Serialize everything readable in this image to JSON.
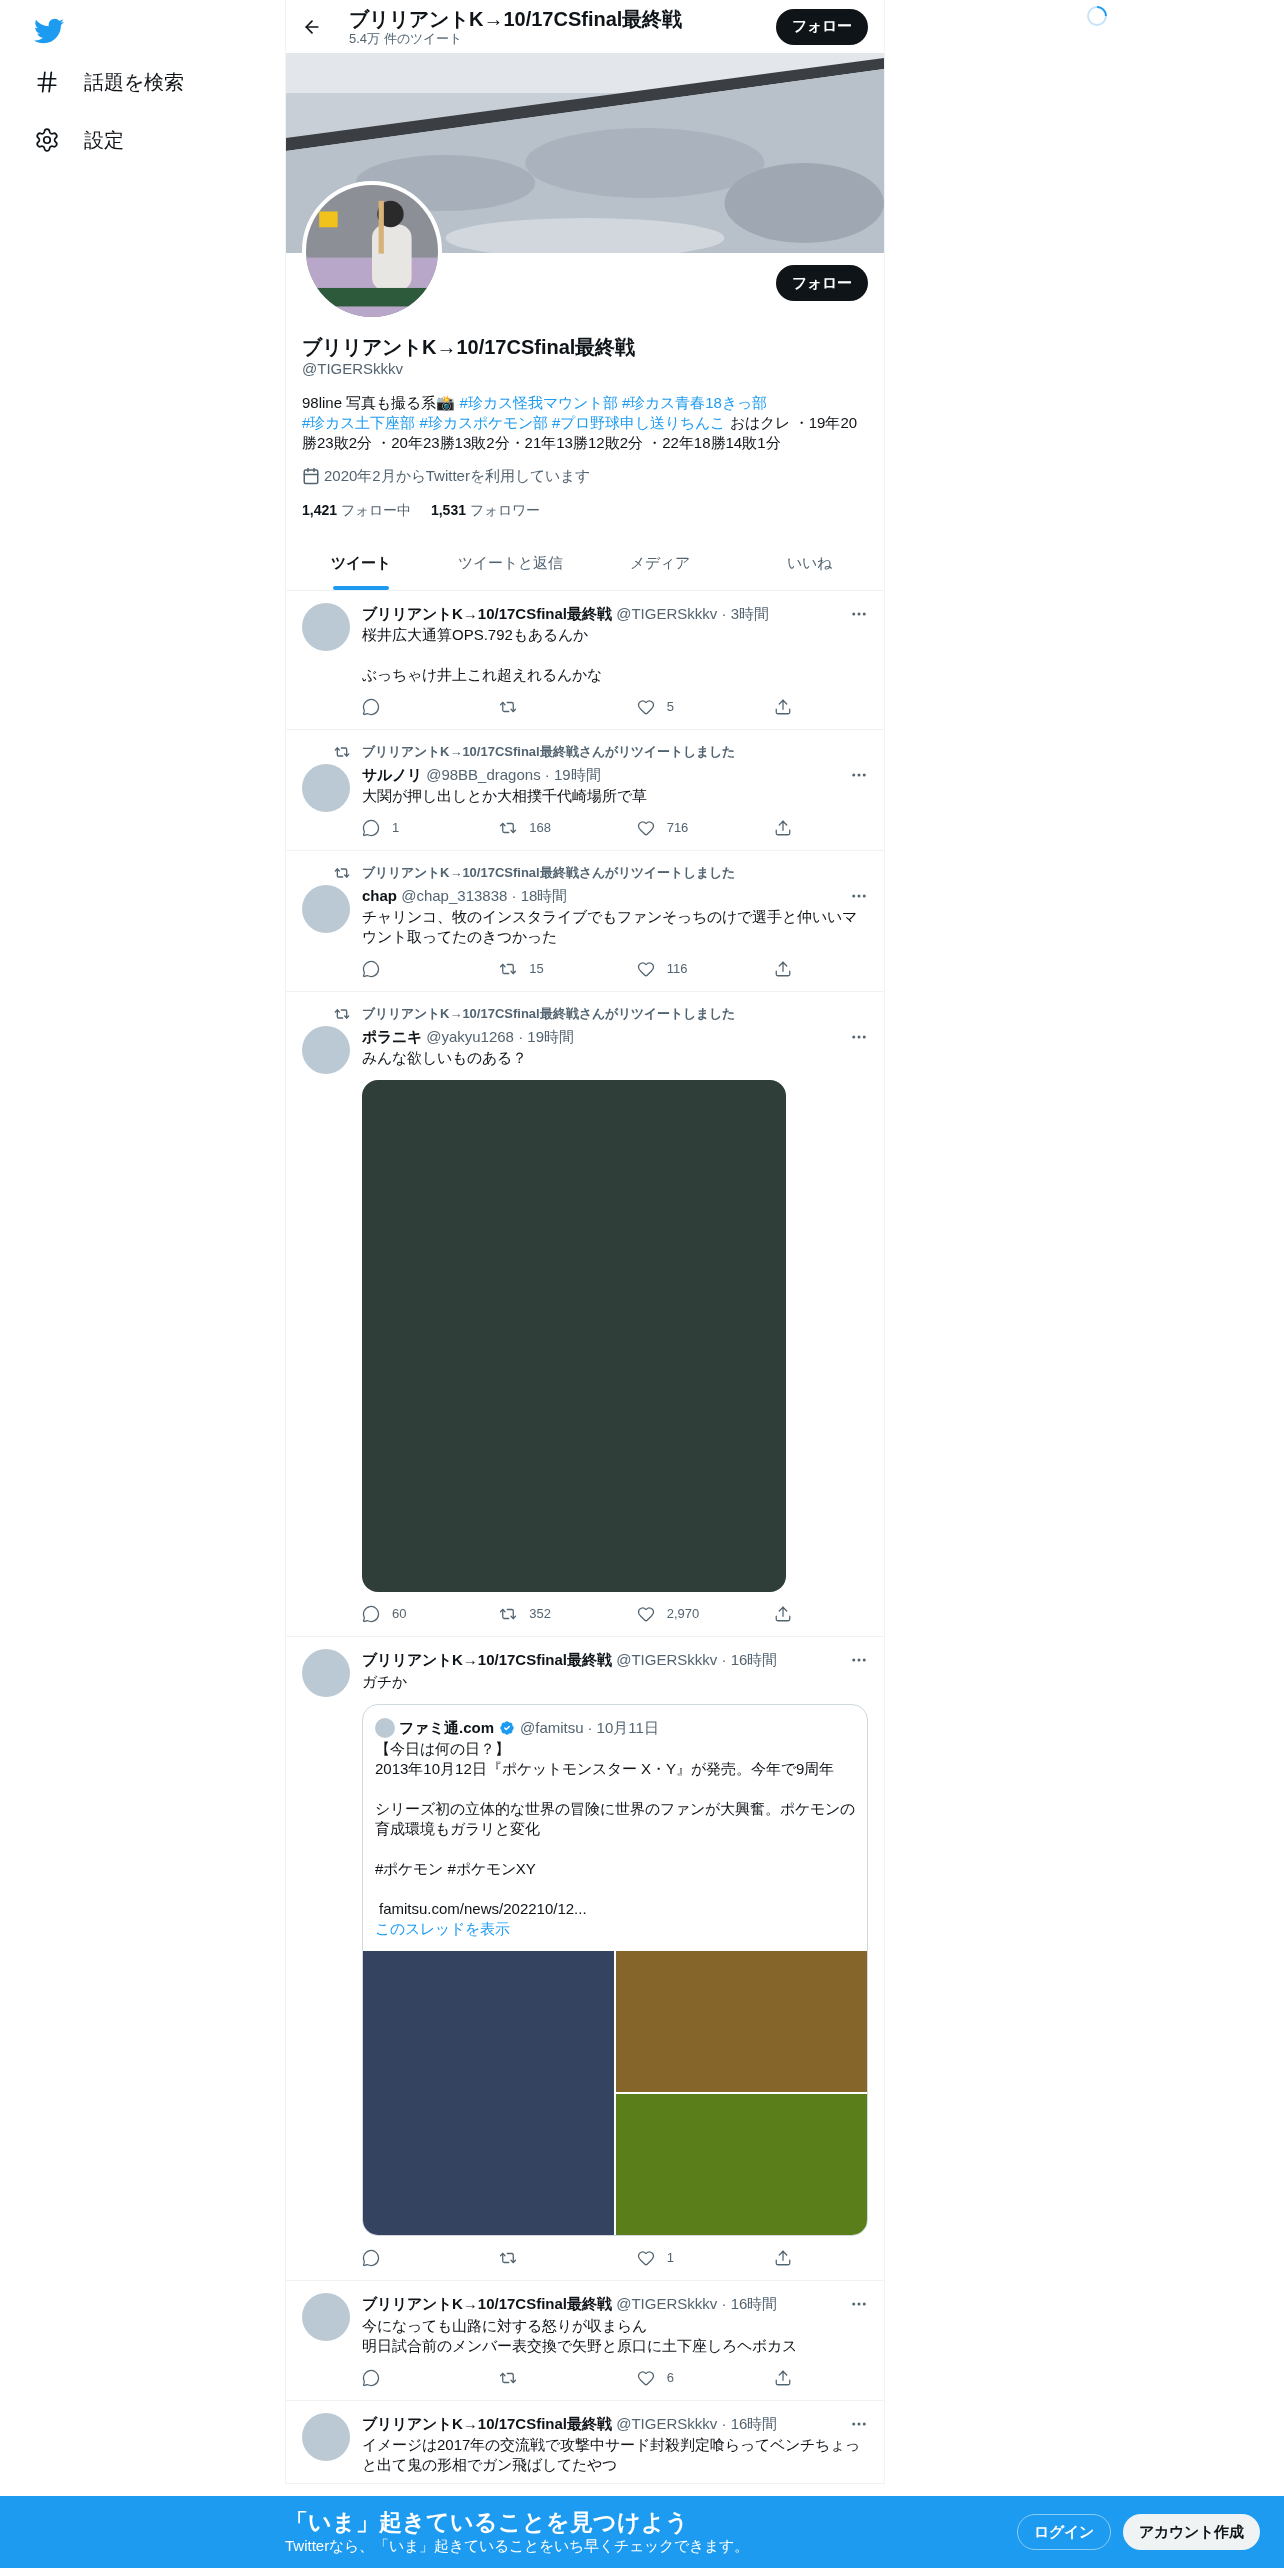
{
  "sidebar": {
    "items": [
      {
        "label": "話題を検索",
        "kind": "hash"
      },
      {
        "label": "設定",
        "kind": "settings"
      }
    ]
  },
  "header": {
    "title": "ブリリアントK→10/17CSfinal最終戦",
    "subtitle": "5.4万 件のツイート",
    "button": "フォロー"
  },
  "profile": {
    "kind": "picture",
    "button": "フォロー",
    "name": "ブリリアントK→10/17CSfinal最終戦",
    "handle": "@TIGERSkkkv",
    "bio": [
      {
        "kind": "text",
        "text": "98line 写真も撮る系📸"
      },
      {
        "kind": "hashtag",
        "text": "#珍カス怪我マウント部"
      },
      {
        "kind": "hashtag",
        "text": "#珍カス青春18きっ部"
      },
      {
        "kind": "hashtag",
        "text": "#珍カス土下座部"
      },
      {
        "kind": "hashtag",
        "text": "#珍カスポケモン部"
      },
      {
        "kind": "hashtag",
        "text": "#プロ野球申し送りちんこ"
      },
      {
        "kind": "text",
        "text": "おはクレ ・19年20勝23敗2分 ・20年23勝13敗2分・21年13勝12敗2分 ・22年18勝14敗1分"
      }
    ],
    "joined": "2020年2月からTwitterを利用しています",
    "stats": [
      {
        "count": "1,421",
        "label": "フォロー中"
      },
      {
        "count": "1,531",
        "label": "フォロワー"
      }
    ]
  },
  "tabs": [
    {
      "label": "ツイート",
      "selected": true
    },
    {
      "label": "ツイートと返信",
      "selected": false
    },
    {
      "label": "メディア",
      "selected": false
    },
    {
      "label": "いいね",
      "selected": false
    }
  ],
  "tweets": [
    {
      "name": "ブリリアントK→10/17CSfinal最終戦",
      "handle": "@TIGERSkkkv",
      "dot": "·",
      "time": "3時間",
      "paragraphs": [
        [
          "桜井広大通算OPS.792もあるんか"
        ],
        [
          "ぶっちゃけ井上これ超えれるんかな"
        ]
      ],
      "counts": {
        "like": "5"
      }
    },
    {
      "retweeted_by": "ブリリアントK→10/17CSfinal最終戦さんがリツイートしました",
      "name": "サルノリ",
      "handle": "@98BB_dragons",
      "dot": "·",
      "time": "19時間",
      "paragraphs": [
        [
          "大関が押し出しとか大相撲千代崎場所で草"
        ]
      ],
      "counts": {
        "reply": "1",
        "retweet": "168",
        "like": "716"
      }
    },
    {
      "retweeted_by": "ブリリアントK→10/17CSfinal最終戦さんがリツイートしました",
      "name": "chap",
      "handle": "@chap_313838",
      "dot": "·",
      "time": "18時間",
      "paragraphs": [
        [
          "チャリンコ、牧のインスタライブでもファンそっちのけで選手と仲いいマウント取ってたのきつかった"
        ]
      ],
      "counts": {
        "retweet": "15",
        "like": "116"
      }
    },
    {
      "retweeted_by": "ブリリアントK→10/17CSfinal最終戦さんがリツイートしました",
      "name": "ポラニキ",
      "handle": "@yakyu1268",
      "dot": "·",
      "time": "19時間",
      "paragraphs": [
        [
          "みんな欲しいものある？"
        ]
      ],
      "media": {
        "kind": "single",
        "images": [
          {
            "color": "#2f3e38"
          }
        ]
      },
      "counts": {
        "reply": "60",
        "retweet": "352",
        "like": "2,970"
      }
    },
    {
      "name": "ブリリアントK→10/17CSfinal最終戦",
      "handle": "@TIGERSkkkv",
      "dot": "·",
      "time": "16時間",
      "paragraphs": [
        [
          "ガチか"
        ]
      ],
      "quote": {
        "name": "ファミ通.com",
        "verified": true,
        "handle": "@famitsu",
        "dot": "·",
        "time": "10月11日",
        "paragraphs": [
          [
            "【今日は何の日？】",
            "2013年10月12日『ポケットモンスター X・Y』が発売。今年で9周年"
          ],
          [
            "シリーズ初の立体的な世界の冒険に世界のファンが大興奮。ポケモンの育成環境もガラリと変化"
          ],
          [
            "#ポケモン #ポケモンXY"
          ]
        ],
        "link": "famitsu.com/news/202210/12...",
        "thread": "このスレッドを表示",
        "images": [
          {
            "color": "#34435f"
          },
          {
            "color": "#86652a"
          },
          {
            "color": "#5a7f1a"
          }
        ]
      },
      "counts": {
        "like": "1"
      }
    },
    {
      "name": "ブリリアントK→10/17CSfinal最終戦",
      "handle": "@TIGERSkkkv",
      "dot": "·",
      "time": "16時間",
      "paragraphs": [
        [
          "今になっても山路に対する怒りが収まらん",
          "明日試合前のメンバー表交換で矢野と原口に土下座しろヘボカス"
        ]
      ],
      "counts": {
        "like": "6"
      }
    },
    {
      "name": "ブリリアントK→10/17CSfinal最終戦",
      "handle": "@TIGERSkkkv",
      "dot": "·",
      "time": "16時間",
      "paragraphs": [
        [
          "イメージは2017年の交流戦で攻撃中サード封殺判定喰らってベンチちょっと出て鬼の形相でガン飛ばしてたやつ"
        ]
      ]
    }
  ],
  "banner": {
    "title": "「いま」起きていることを見つけよう",
    "subtitle": "Twitterなら、「いま」起きていることをいち早くチェックできます。",
    "buttons": [
      {
        "label": "ログイン",
        "kind": "outline"
      },
      {
        "label": "アカウント作成",
        "kind": "solid"
      }
    ]
  }
}
